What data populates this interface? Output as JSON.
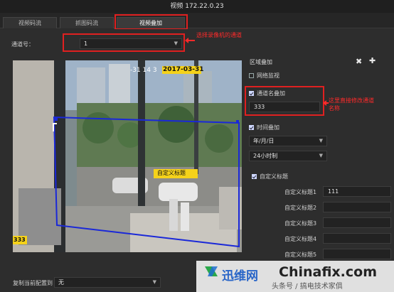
{
  "window": {
    "title": "视频 172.22.0.23"
  },
  "tabs": [
    {
      "label": "视频码流",
      "active": false
    },
    {
      "label": "抓图码流",
      "active": false
    },
    {
      "label": "视频叠加",
      "active": true
    }
  ],
  "channel": {
    "label": "通道号：",
    "value": "1"
  },
  "annotations": {
    "channel_note": "选择录像机的通道",
    "name_note_line1": "这里直接修改通道",
    "name_note_line2": "名称"
  },
  "video": {
    "timestamp": "2017-03-31",
    "timestamp_partial": "-31 14 3",
    "custom_title_overlay": "自定义标题",
    "channel_name_overlay": "333"
  },
  "region_overlay": {
    "title": "区域叠加",
    "close_icon": "✖",
    "add_icon": "✚"
  },
  "network_monitor": {
    "label": "网络监视",
    "checked": false
  },
  "channel_name_overlay": {
    "label": "通道名叠加",
    "checked": true,
    "value": "333"
  },
  "time_overlay": {
    "label": "时间叠加",
    "checked": true,
    "date_format": "年/月/日",
    "time_format": "24小时制"
  },
  "custom_title": {
    "label": "自定义标题",
    "checked": true,
    "rows": [
      {
        "label": "自定义标题1",
        "value": "111"
      },
      {
        "label": "自定义标题2",
        "value": ""
      },
      {
        "label": "自定义标题3",
        "value": ""
      },
      {
        "label": "自定义标题4",
        "value": ""
      },
      {
        "label": "自定义标题5",
        "value": ""
      }
    ]
  },
  "copy_config": {
    "label": "复制当前配置到",
    "value": "无"
  },
  "watermark": {
    "cn": "迅维网",
    "en": "Chinafix.com",
    "sub": "头条号 / 搞电技术家俱"
  },
  "colors": {
    "accent_red": "#e02020",
    "overlay_yellow": "#f5d21a",
    "region_blue": "#1a28d8"
  }
}
